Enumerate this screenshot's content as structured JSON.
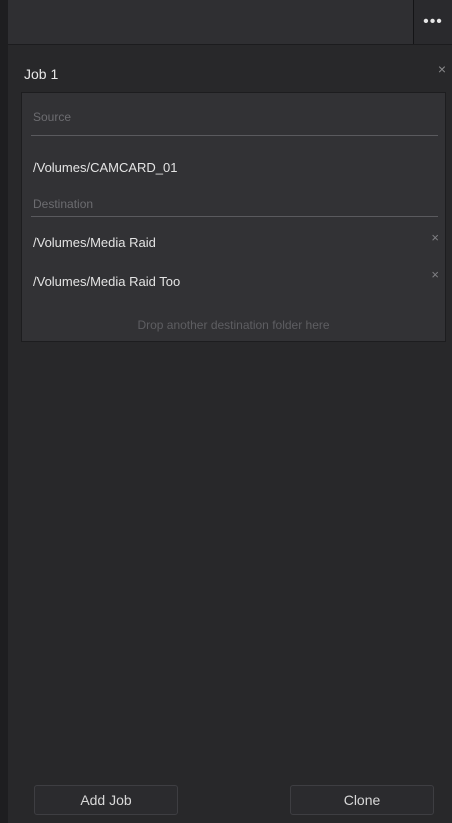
{
  "topbar": {
    "more_label": "•••",
    "more_icon": "more-horizontal-icon"
  },
  "job": {
    "title": "Job 1",
    "close_glyph": "×",
    "source_label": "Source",
    "source_path": "/Volumes/CAMCARD_01",
    "destination_label": "Destination",
    "destinations": [
      {
        "path": "/Volumes/Media Raid",
        "remove_glyph": "×"
      },
      {
        "path": "/Volumes/Media Raid Too",
        "remove_glyph": "×"
      }
    ],
    "drop_hint": "Drop another destination folder here"
  },
  "footer": {
    "add_job_label": "Add Job",
    "clone_label": "Clone"
  }
}
